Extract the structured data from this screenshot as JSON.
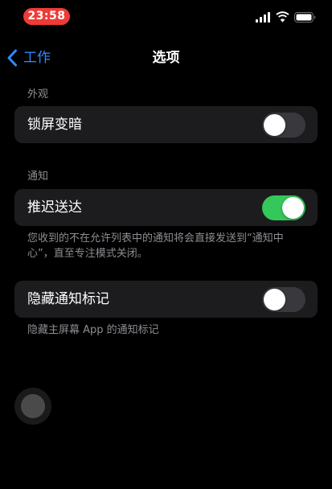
{
  "status_bar": {
    "time": "23:58",
    "time_pill_color": "#ef3b36",
    "icons": [
      "signal-icon",
      "wifi-icon",
      "battery-icon"
    ]
  },
  "nav": {
    "back_label": "工作",
    "title": "选项",
    "accent_color": "#2f8bff"
  },
  "sections": [
    {
      "header": "外观",
      "rows": [
        {
          "label": "锁屏变暗",
          "toggle_on": false
        }
      ]
    },
    {
      "header": "通知",
      "rows": [
        {
          "label": "推迟送达",
          "toggle_on": true
        }
      ],
      "footer": "您收到的不在允许列表中的通知将会直接发送到“通知中心”，直至专注模式关闭。"
    },
    {
      "header": "",
      "rows": [
        {
          "label": "隐藏通知标记",
          "toggle_on": false
        }
      ],
      "footer": "隐藏主屏幕 App 的通知标记"
    }
  ],
  "colors": {
    "toggle_on": "#34c759",
    "toggle_off": "#39393d",
    "card_bg": "#1c1c1e",
    "secondary_text": "#8d8d93"
  }
}
